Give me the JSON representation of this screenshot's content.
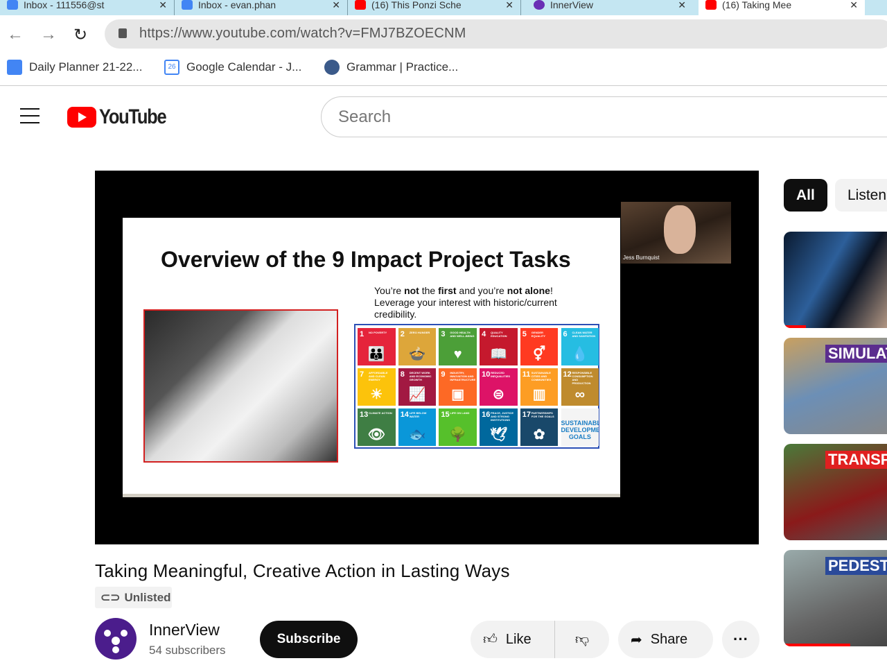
{
  "browser": {
    "tabs": [
      {
        "label": "Inbox - 111556@st",
        "favicon": "gmail-icon"
      },
      {
        "label": "Inbox - evan.phan",
        "favicon": "gmail-icon"
      },
      {
        "label": "(16) This Ponzi Sche",
        "favicon": "youtube-icon"
      },
      {
        "label": "InnerView",
        "favicon": "innerview-icon"
      },
      {
        "label": "(16) Taking Mee",
        "favicon": "youtube-icon",
        "active": true
      }
    ],
    "url": "https://www.youtube.com/watch?v=FMJ7BZOECNM",
    "bookmarks": [
      {
        "label": "Daily Planner 21-22...",
        "icon": "docs-icon"
      },
      {
        "label": "Google Calendar - J...",
        "icon": "calendar-icon",
        "icon_text": "26"
      },
      {
        "label": "Grammar | Practice...",
        "icon": "grammar-icon"
      }
    ]
  },
  "youtube": {
    "logo_text": "YouTube",
    "search_placeholder": "Search",
    "video": {
      "slide_title": "Overview of the 9 Impact Project Tasks",
      "slide_text_1a": "You’re ",
      "slide_text_1b": "not",
      "slide_text_1c": " the ",
      "slide_text_1d": "first",
      "slide_text_1e": " and you’re ",
      "slide_text_1f": "not alone",
      "slide_text_1g": "!",
      "slide_text_2": "Leverage your interest with historic/current credibility.",
      "webcam_name": "Jess Burnquist",
      "sdg_tiles": [
        {
          "n": "1",
          "t": "NO POVERTY",
          "c": "#E5243B",
          "g": "👪"
        },
        {
          "n": "2",
          "t": "ZERO HUNGER",
          "c": "#DDA63A",
          "g": "🍲"
        },
        {
          "n": "3",
          "t": "GOOD HEALTH AND WELL-BEING",
          "c": "#4C9F38",
          "g": "♥"
        },
        {
          "n": "4",
          "t": "QUALITY EDUCATION",
          "c": "#C5192D",
          "g": "📖"
        },
        {
          "n": "5",
          "t": "GENDER EQUALITY",
          "c": "#FF3A21",
          "g": "⚥"
        },
        {
          "n": "6",
          "t": "CLEAN WATER AND SANITATION",
          "c": "#26BDE2",
          "g": "💧"
        },
        {
          "n": "7",
          "t": "AFFORDABLE AND CLEAN ENERGY",
          "c": "#FCC30B",
          "g": "☀"
        },
        {
          "n": "8",
          "t": "DECENT WORK AND ECONOMIC GROWTH",
          "c": "#A21942",
          "g": "📈"
        },
        {
          "n": "9",
          "t": "INDUSTRY, INNOVATION AND INFRASTRUCTURE",
          "c": "#FD6925",
          "g": "▣"
        },
        {
          "n": "10",
          "t": "REDUCED INEQUALITIES",
          "c": "#DD1367",
          "g": "⊜"
        },
        {
          "n": "11",
          "t": "SUSTAINABLE CITIES AND COMMUNITIES",
          "c": "#FD9D24",
          "g": "▥"
        },
        {
          "n": "12",
          "t": "RESPONSIBLE CONSUMPTION AND PRODUCTION",
          "c": "#BF8B2E",
          "g": "∞"
        },
        {
          "n": "13",
          "t": "CLIMATE ACTION",
          "c": "#3F7E44",
          "g": "👁"
        },
        {
          "n": "14",
          "t": "LIFE BELOW WATER",
          "c": "#0A97D9",
          "g": "🐟"
        },
        {
          "n": "15",
          "t": "LIFE ON LAND",
          "c": "#56C02B",
          "g": "🌳"
        },
        {
          "n": "16",
          "t": "PEACE, JUSTICE AND STRONG INSTITUTIONS",
          "c": "#00689D",
          "g": "🕊"
        },
        {
          "n": "17",
          "t": "PARTNERSHIPS FOR THE GOALS",
          "c": "#19486A",
          "g": "✿"
        }
      ],
      "sdg_logo": "SUSTAINABLE DEVELOPMENT GOALS",
      "title": "Taking Meaningful, Creative Action in Lasting Ways",
      "visibility": "Unlisted"
    },
    "channel": {
      "name": "InnerView",
      "subscribers": "54 subscribers"
    },
    "actions": {
      "subscribe": "Subscribe",
      "like": "Like",
      "share": "Share",
      "more": "···"
    },
    "chips": [
      "All",
      "Listen"
    ],
    "related": [
      {
        "caption": "",
        "progress": 0.2
      },
      {
        "caption": "SIMULAT URBANI",
        "progress": 0
      },
      {
        "caption": "TRANSPO VIOLI",
        "progress": 0
      },
      {
        "caption": "PEDESTRIAN-UN NIGHTMA",
        "progress": 0.6
      }
    ]
  }
}
